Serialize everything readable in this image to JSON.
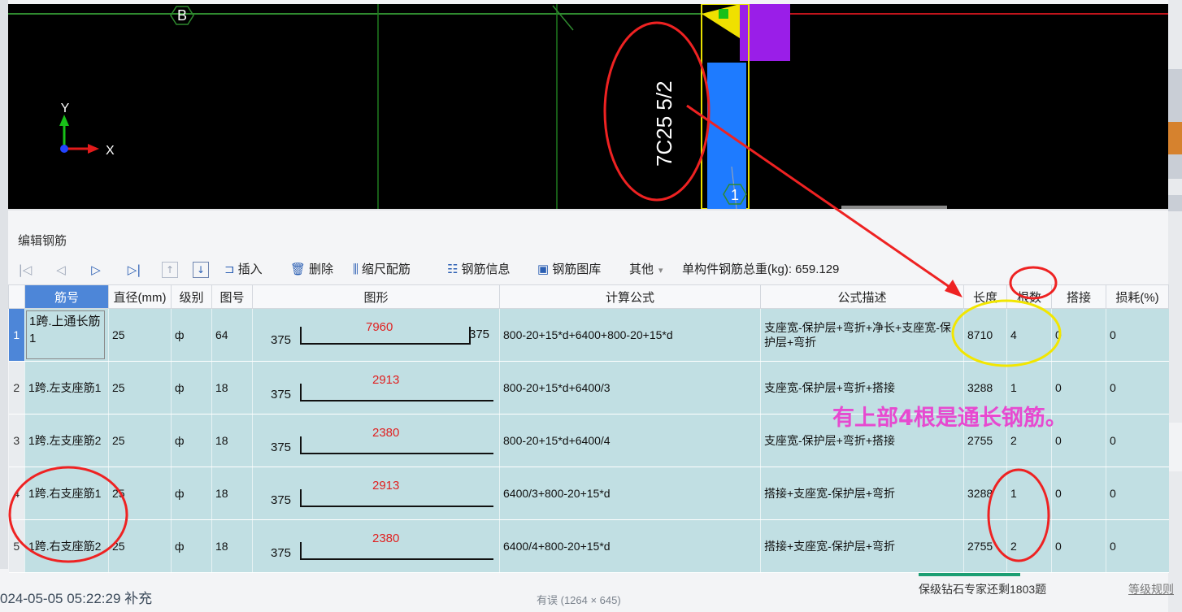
{
  "cad": {
    "axis_b": "B",
    "axis_1": "1",
    "axis_x": "X",
    "axis_y": "Y",
    "rebar_label": "7C25 5/2"
  },
  "panel": {
    "title": "编辑钢筋",
    "toolbar": {
      "insert": "插入",
      "delete": "删除",
      "scale": "缩尺配筋",
      "info": "钢筋信息",
      "library": "钢筋图库",
      "other": "其他",
      "total_weight": "单构件钢筋总重(kg): 659.129"
    },
    "columns": [
      "筋号",
      "直径(mm)",
      "级别",
      "图号",
      "图形",
      "计算公式",
      "公式描述",
      "长度",
      "根数",
      "搭接",
      "损耗(%)"
    ],
    "rows": [
      {
        "no": "1",
        "name": "1跨.上通长筋1",
        "dia": "25",
        "grade": "ф",
        "fig": "64",
        "left": "375",
        "mid": "7960",
        "right": "375",
        "formula": "800-20+15*d+6400+800-20+15*d",
        "desc": "支座宽-保护层+弯折+净长+支座宽-保护层+弯折",
        "length": "8710",
        "count": "4",
        "lap": "0",
        "loss": "0"
      },
      {
        "no": "2",
        "name": "1跨.左支座筋1",
        "dia": "25",
        "grade": "ф",
        "fig": "18",
        "left": "375",
        "mid": "2913",
        "right": "",
        "formula": "800-20+15*d+6400/3",
        "desc": "支座宽-保护层+弯折+搭接",
        "length": "3288",
        "count": "1",
        "lap": "0",
        "loss": "0"
      },
      {
        "no": "3",
        "name": "1跨.左支座筋2",
        "dia": "25",
        "grade": "ф",
        "fig": "18",
        "left": "375",
        "mid": "2380",
        "right": "",
        "formula": "800-20+15*d+6400/4",
        "desc": "支座宽-保护层+弯折+搭接",
        "length": "2755",
        "count": "2",
        "lap": "0",
        "loss": "0"
      },
      {
        "no": "4",
        "name": "1跨.右支座筋1",
        "dia": "25",
        "grade": "ф",
        "fig": "18",
        "left": "375",
        "mid": "2913",
        "right": "",
        "formula": "6400/3+800-20+15*d",
        "desc": "搭接+支座宽-保护层+弯折",
        "length": "3288",
        "count": "1",
        "lap": "0",
        "loss": "0"
      },
      {
        "no": "5",
        "name": "1跨.右支座筋2",
        "dia": "25",
        "grade": "ф",
        "fig": "18",
        "left": "375",
        "mid": "2380",
        "right": "",
        "formula": "6400/4+800-20+15*d",
        "desc": "搭接+支座宽-保护层+弯折",
        "length": "2755",
        "count": "2",
        "lap": "0",
        "loss": "0"
      }
    ]
  },
  "annotation": "有上部4根是通长钢筋。",
  "footer": {
    "left": "024-05-05 05:22:29 补充",
    "mid": "有误 (1264 × 645)",
    "right_text": "保级钻石专家还剩1803题",
    "right_link": "等级规则"
  },
  "colors": {
    "annotation": "#e64ad0",
    "circle_red": "#ee2222",
    "circle_yellow": "#f2e600",
    "selected_header": "#4d86d8",
    "row_bg": "#c1dfe3"
  }
}
